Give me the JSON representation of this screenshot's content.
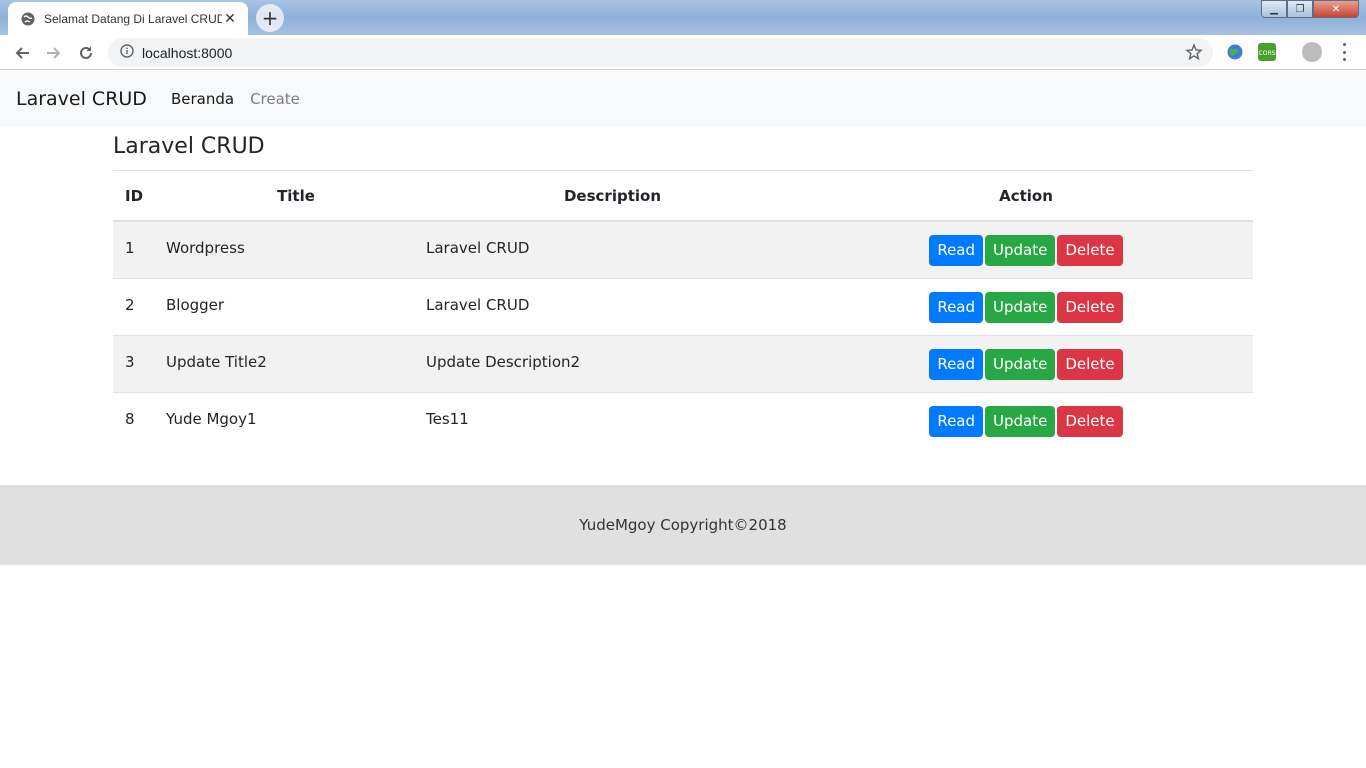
{
  "browser": {
    "tab_title": "Selamat Datang Di Laravel CRUD",
    "tab_close": "✕",
    "new_tab": "+",
    "url": "localhost:8000",
    "accent": "#1a73e8"
  },
  "navbar": {
    "brand": "Laravel CRUD",
    "links": [
      {
        "label": "Beranda",
        "active": true
      },
      {
        "label": "Create",
        "active": false
      }
    ]
  },
  "main": {
    "heading": "Laravel CRUD",
    "table": {
      "headers": [
        "ID",
        "Title",
        "Description",
        "Action"
      ],
      "rows": [
        {
          "id": "1",
          "title": "Wordpress",
          "description": "Laravel CRUD"
        },
        {
          "id": "2",
          "title": "Blogger",
          "description": "Laravel CRUD"
        },
        {
          "id": "3",
          "title": "Update Title2",
          "description": "Update Description2"
        },
        {
          "id": "8",
          "title": "Yude Mgoy1",
          "description": "Tes11"
        }
      ],
      "actions": {
        "read": "Read",
        "update": "Update",
        "delete": "Delete"
      }
    }
  },
  "footer": {
    "text": "YudeMgoy Copyright©2018"
  },
  "colors": {
    "read": "#007bff",
    "update": "#28a745",
    "delete": "#dc3545",
    "navbar_bg": "#f8f9fa",
    "footer_bg": "#e0e0e0"
  }
}
